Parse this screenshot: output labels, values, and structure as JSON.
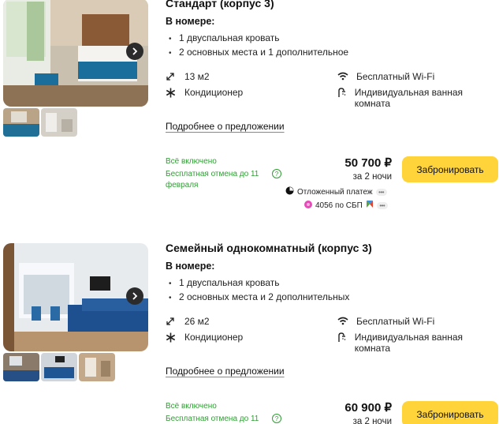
{
  "offers": [
    {
      "title": "Стандарт (корпус 3)",
      "in_room_label": "В номере:",
      "beds": [
        "1 двуспальная кровать",
        "2 основных места и 1 дополнительное"
      ],
      "amenities": {
        "area": "13 м2",
        "ac": "Кондиционер",
        "wifi": "Бесплатный Wi-Fi",
        "bath": "Индивидуальная ванная комната"
      },
      "more_link": "Подробнее о предложении",
      "included": "Всё включено",
      "cancel": "Бесплатная отмена до 11 февраля",
      "price": "50 700 ₽",
      "nights": "за 2 ночи",
      "book_label": "Забронировать",
      "deferred": "Отложенный платеж",
      "sbp": "4056 по СБП"
    },
    {
      "title": "Семейный однокомнатный (корпус 3)",
      "in_room_label": "В номере:",
      "beds": [
        "1 двуспальная кровать",
        "2 основных места и 2 дополнительных"
      ],
      "amenities": {
        "area": "26 м2",
        "ac": "Кондиционер",
        "wifi": "Бесплатный Wi-Fi",
        "bath": "Индивидуальная ванная комната"
      },
      "more_link": "Подробнее о предложении",
      "included": "Всё включено",
      "cancel": "Бесплатная отмена до 11",
      "price": "60 900 ₽",
      "nights": "за 2 ночи",
      "book_label": "Забронировать"
    }
  ],
  "icons": {
    "area": "expand-arrows-icon",
    "ac": "snowflake-icon",
    "wifi": "wifi-icon",
    "bath": "shower-icon",
    "next": "chevron-right-icon",
    "help": "question-circle-icon"
  },
  "colors": {
    "accent_button": "#ffd43b",
    "green_text": "#2f9e33"
  }
}
